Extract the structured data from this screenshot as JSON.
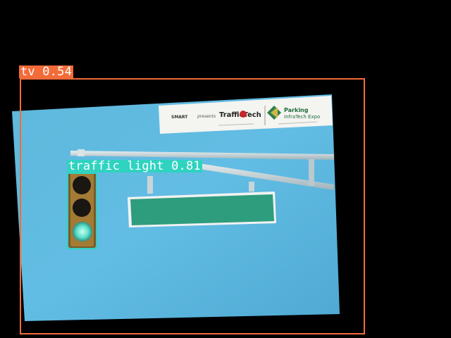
{
  "detections": [
    {
      "label": "tv",
      "score": "0.54",
      "text": "tv 0.54",
      "color": "#f26b38"
    },
    {
      "label": "traffic light",
      "score": "0.81",
      "text": "traffic light 0.81",
      "color": "#2fd3c0"
    }
  ],
  "banner": {
    "logo_smart": "SMART",
    "presents": "presents",
    "logo_traffic": "TrafficTech",
    "logo_parking_1": "Parking",
    "logo_parking_2": "InfraTech Expo"
  }
}
